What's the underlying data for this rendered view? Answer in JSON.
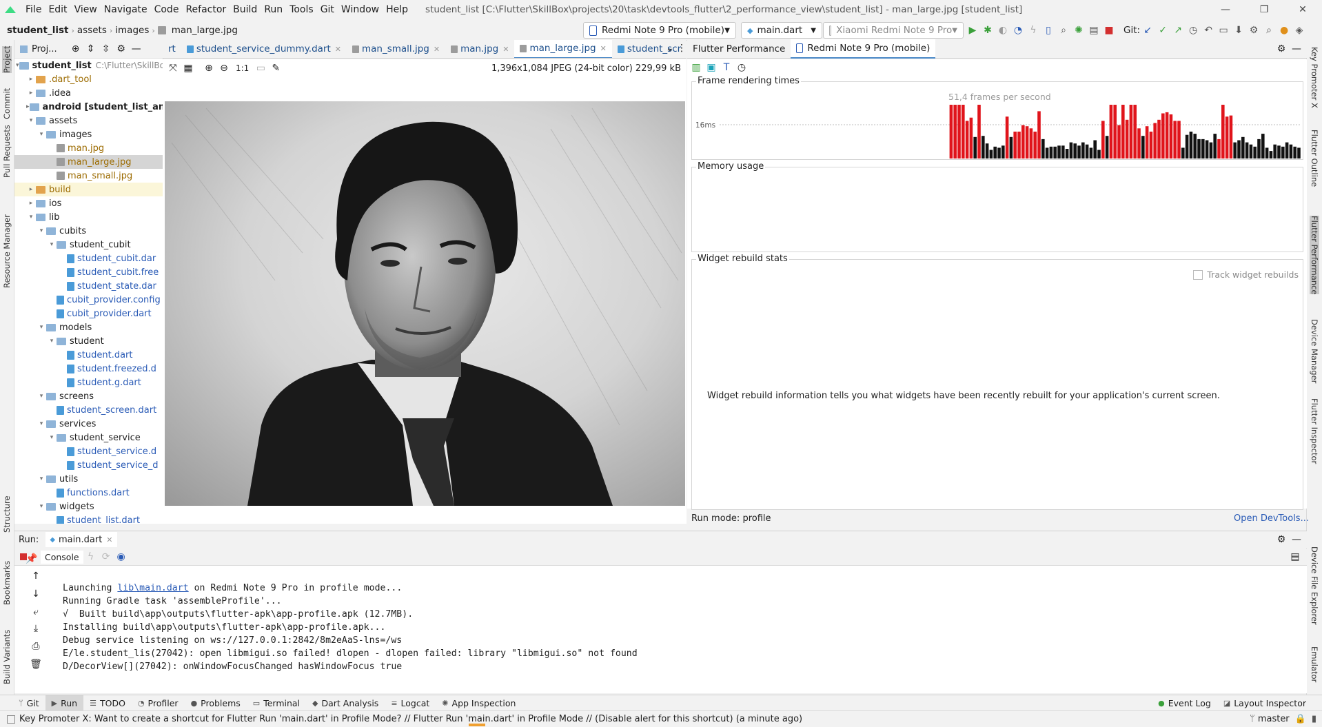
{
  "menubar": {
    "items": [
      "File",
      "Edit",
      "View",
      "Navigate",
      "Code",
      "Refactor",
      "Build",
      "Run",
      "Tools",
      "Git",
      "Window",
      "Help"
    ],
    "window_title": "student_list [C:\\Flutter\\SkillBox\\projects\\20\\task\\devtools_flutter\\2_performance_view\\student_list] - man_large.jpg [student_list]"
  },
  "navbar": {
    "breadcrumbs": [
      "student_list",
      "assets",
      "images",
      "man_large.jpg"
    ],
    "device_selector": "Redmi Note 9 Pro (mobile)",
    "run_config": "main.dart",
    "device_secondary": "Xiaomi Redmi Note 9 Pro",
    "git_label": "Git:"
  },
  "left_stripe": [
    "Project",
    "Commit",
    "Pull Requests",
    "Resource Manager",
    "Structure",
    "Bookmarks",
    "Build Variants"
  ],
  "right_stripe": [
    "Key Promoter X",
    "Flutter Outline",
    "Flutter Performance",
    "Device Manager",
    "Flutter Inspector",
    "Device File Explorer",
    "Emulator"
  ],
  "project": {
    "header": "Proj...",
    "root_name": "student_list",
    "root_path": "C:\\Flutter\\SkillBo",
    "tree": [
      {
        "label": ".dart_tool",
        "depth": 1,
        "kind": "folder-orange",
        "arrow": "▸",
        "style": "yellow"
      },
      {
        "label": ".idea",
        "depth": 1,
        "kind": "folder",
        "arrow": "▸"
      },
      {
        "label": "android [student_list_and",
        "depth": 1,
        "kind": "folder",
        "arrow": "▸",
        "bold": true
      },
      {
        "label": "assets",
        "depth": 1,
        "kind": "folder",
        "arrow": "▾"
      },
      {
        "label": "images",
        "depth": 2,
        "kind": "folder",
        "arrow": "▾"
      },
      {
        "label": "man.jpg",
        "depth": 3,
        "kind": "image",
        "arrow": "",
        "style": "yellow"
      },
      {
        "label": "man_large.jpg",
        "depth": 3,
        "kind": "image",
        "arrow": "",
        "style": "yellow",
        "selected": true
      },
      {
        "label": "man_small.jpg",
        "depth": 3,
        "kind": "image",
        "arrow": "",
        "style": "yellow"
      },
      {
        "label": "build",
        "depth": 1,
        "kind": "folder-orange",
        "arrow": "▸",
        "style": "yellow",
        "highlight": true
      },
      {
        "label": "ios",
        "depth": 1,
        "kind": "folder",
        "arrow": "▸"
      },
      {
        "label": "lib",
        "depth": 1,
        "kind": "folder",
        "arrow": "▾"
      },
      {
        "label": "cubits",
        "depth": 2,
        "kind": "folder",
        "arrow": "▾"
      },
      {
        "label": "student_cubit",
        "depth": 3,
        "kind": "folder",
        "arrow": "▾"
      },
      {
        "label": "student_cubit.dar",
        "depth": 4,
        "kind": "file",
        "arrow": "",
        "style": "blue"
      },
      {
        "label": "student_cubit.free",
        "depth": 4,
        "kind": "file",
        "arrow": "",
        "style": "blue"
      },
      {
        "label": "student_state.dar",
        "depth": 4,
        "kind": "file",
        "arrow": "",
        "style": "blue"
      },
      {
        "label": "cubit_provider.config",
        "depth": 3,
        "kind": "file",
        "arrow": "",
        "style": "blue"
      },
      {
        "label": "cubit_provider.dart",
        "depth": 3,
        "kind": "file",
        "arrow": "",
        "style": "blue"
      },
      {
        "label": "models",
        "depth": 2,
        "kind": "folder",
        "arrow": "▾"
      },
      {
        "label": "student",
        "depth": 3,
        "kind": "folder",
        "arrow": "▾"
      },
      {
        "label": "student.dart",
        "depth": 4,
        "kind": "file",
        "arrow": "",
        "style": "blue"
      },
      {
        "label": "student.freezed.d",
        "depth": 4,
        "kind": "file",
        "arrow": "",
        "style": "blue"
      },
      {
        "label": "student.g.dart",
        "depth": 4,
        "kind": "file",
        "arrow": "",
        "style": "blue"
      },
      {
        "label": "screens",
        "depth": 2,
        "kind": "folder",
        "arrow": "▾"
      },
      {
        "label": "student_screen.dart",
        "depth": 3,
        "kind": "file",
        "arrow": "",
        "style": "blue"
      },
      {
        "label": "services",
        "depth": 2,
        "kind": "folder",
        "arrow": "▾"
      },
      {
        "label": "student_service",
        "depth": 3,
        "kind": "folder",
        "arrow": "▾"
      },
      {
        "label": "student_service.d",
        "depth": 4,
        "kind": "file",
        "arrow": "",
        "style": "blue"
      },
      {
        "label": "student_service_d",
        "depth": 4,
        "kind": "file",
        "arrow": "",
        "style": "blue"
      },
      {
        "label": "utils",
        "depth": 2,
        "kind": "folder",
        "arrow": "▾"
      },
      {
        "label": "functions.dart",
        "depth": 3,
        "kind": "file",
        "arrow": "",
        "style": "blue"
      },
      {
        "label": "widgets",
        "depth": 2,
        "kind": "folder",
        "arrow": "▾"
      },
      {
        "label": "student_list.dart",
        "depth": 3,
        "kind": "file",
        "arrow": "",
        "style": "blue"
      }
    ]
  },
  "editor": {
    "tabs": [
      {
        "label": "rt",
        "active": false,
        "closable": false
      },
      {
        "label": "student_service_dummy.dart",
        "active": false,
        "closable": true
      },
      {
        "label": "man_small.jpg",
        "active": false,
        "closable": true
      },
      {
        "label": "man.jpg",
        "active": false,
        "closable": true
      },
      {
        "label": "man_large.jpg",
        "active": true,
        "closable": true
      },
      {
        "label": "student_scr",
        "active": false,
        "closable": false
      }
    ],
    "zoom_label": "1:1",
    "image_info": "1,396x1,084 JPEG (24-bit color) 229,99 kB"
  },
  "flutter_performance": {
    "tabs": [
      "Flutter Performance",
      "Redmi Note 9 Pro (mobile)"
    ],
    "frame_title": "Frame rendering times",
    "fps_label": "51,4 frames per second",
    "threshold_label": "16ms",
    "frames": [
      {
        "h": 1.0,
        "jank": true
      },
      {
        "h": 1.0,
        "jank": true
      },
      {
        "h": 1.0,
        "jank": true
      },
      {
        "h": 1.0,
        "jank": true
      },
      {
        "h": 0.7,
        "jank": true
      },
      {
        "h": 0.76,
        "jank": true
      },
      {
        "h": 0.4,
        "jank": false
      },
      {
        "h": 1.0,
        "jank": true
      },
      {
        "h": 0.42,
        "jank": false
      },
      {
        "h": 0.28,
        "jank": false
      },
      {
        "h": 0.16,
        "jank": false
      },
      {
        "h": 0.22,
        "jank": false
      },
      {
        "h": 0.2,
        "jank": false
      },
      {
        "h": 0.24,
        "jank": false
      },
      {
        "h": 0.78,
        "jank": true
      },
      {
        "h": 0.4,
        "jank": false
      },
      {
        "h": 0.5,
        "jank": true
      },
      {
        "h": 0.5,
        "jank": true
      },
      {
        "h": 0.62,
        "jank": true
      },
      {
        "h": 0.6,
        "jank": true
      },
      {
        "h": 0.56,
        "jank": true
      },
      {
        "h": 0.5,
        "jank": true
      },
      {
        "h": 0.88,
        "jank": true
      },
      {
        "h": 0.36,
        "jank": false
      },
      {
        "h": 0.2,
        "jank": false
      },
      {
        "h": 0.22,
        "jank": false
      },
      {
        "h": 0.22,
        "jank": false
      },
      {
        "h": 0.24,
        "jank": false
      },
      {
        "h": 0.24,
        "jank": false
      },
      {
        "h": 0.18,
        "jank": false
      },
      {
        "h": 0.3,
        "jank": false
      },
      {
        "h": 0.28,
        "jank": false
      },
      {
        "h": 0.24,
        "jank": false
      },
      {
        "h": 0.3,
        "jank": false
      },
      {
        "h": 0.26,
        "jank": false
      },
      {
        "h": 0.2,
        "jank": false
      },
      {
        "h": 0.34,
        "jank": false
      },
      {
        "h": 0.16,
        "jank": false
      },
      {
        "h": 0.7,
        "jank": true
      },
      {
        "h": 0.42,
        "jank": false
      },
      {
        "h": 1.0,
        "jank": true
      },
      {
        "h": 1.0,
        "jank": true
      },
      {
        "h": 0.62,
        "jank": true
      },
      {
        "h": 1.0,
        "jank": true
      },
      {
        "h": 0.72,
        "jank": true
      },
      {
        "h": 1.0,
        "jank": true
      },
      {
        "h": 1.0,
        "jank": true
      },
      {
        "h": 0.56,
        "jank": true
      },
      {
        "h": 0.42,
        "jank": false
      },
      {
        "h": 0.6,
        "jank": true
      },
      {
        "h": 0.5,
        "jank": true
      },
      {
        "h": 0.66,
        "jank": true
      },
      {
        "h": 0.72,
        "jank": true
      },
      {
        "h": 0.84,
        "jank": true
      },
      {
        "h": 0.86,
        "jank": true
      },
      {
        "h": 0.82,
        "jank": true
      },
      {
        "h": 0.7,
        "jank": true
      },
      {
        "h": 0.7,
        "jank": true
      },
      {
        "h": 0.2,
        "jank": false
      },
      {
        "h": 0.44,
        "jank": false
      },
      {
        "h": 0.5,
        "jank": false
      },
      {
        "h": 0.46,
        "jank": false
      },
      {
        "h": 0.36,
        "jank": false
      },
      {
        "h": 0.36,
        "jank": false
      },
      {
        "h": 0.34,
        "jank": false
      },
      {
        "h": 0.3,
        "jank": false
      },
      {
        "h": 0.46,
        "jank": false
      },
      {
        "h": 0.36,
        "jank": true
      },
      {
        "h": 1.0,
        "jank": true
      },
      {
        "h": 0.78,
        "jank": true
      },
      {
        "h": 0.8,
        "jank": true
      },
      {
        "h": 0.3,
        "jank": false
      },
      {
        "h": 0.34,
        "jank": false
      },
      {
        "h": 0.4,
        "jank": false
      },
      {
        "h": 0.3,
        "jank": false
      },
      {
        "h": 0.26,
        "jank": false
      },
      {
        "h": 0.22,
        "jank": false
      },
      {
        "h": 0.36,
        "jank": false
      },
      {
        "h": 0.46,
        "jank": false
      },
      {
        "h": 0.2,
        "jank": false
      },
      {
        "h": 0.14,
        "jank": false
      },
      {
        "h": 0.26,
        "jank": false
      },
      {
        "h": 0.24,
        "jank": false
      },
      {
        "h": 0.22,
        "jank": false
      },
      {
        "h": 0.3,
        "jank": false
      },
      {
        "h": 0.26,
        "jank": false
      },
      {
        "h": 0.22,
        "jank": false
      },
      {
        "h": 0.2,
        "jank": false
      }
    ],
    "memory_title": "Memory usage",
    "rebuild_title": "Widget rebuild stats",
    "track_label": "Track widget rebuilds",
    "rebuild_info": "Widget rebuild information tells you what widgets have been recently rebuilt for your application's current screen.",
    "run_mode": "Run mode: profile",
    "open_devtools": "Open DevTools..."
  },
  "run_panel": {
    "label": "Run:",
    "tab": "main.dart",
    "console_tab": "Console",
    "log": {
      "l1_prefix": "Launching ",
      "l1_link": "lib\\main.dart",
      "l1_suffix": " on Redmi Note 9 Pro in profile mode...",
      "l2": "Running Gradle task 'assembleProfile'...",
      "l3": "√  Built build\\app\\outputs\\flutter-apk\\app-profile.apk (12.7MB).",
      "l4": "Installing build\\app\\outputs\\flutter-apk\\app-profile.apk...",
      "l5": "Debug service listening on ws://127.0.0.1:2842/8m2eAaS-lns=/ws",
      "l6": "E/le.student_lis(27042): open libmigui.so failed! dlopen - dlopen failed: library \"libmigui.so\" not found",
      "l7": "D/DecorView[](27042): onWindowFocusChanged hasWindowFocus true"
    }
  },
  "bottom_tools": {
    "left": [
      "Git",
      "Run",
      "TODO",
      "Profiler",
      "Problems",
      "Terminal",
      "Dart Analysis",
      "Logcat",
      "App Inspection"
    ],
    "right": [
      "Event Log",
      "Layout Inspector"
    ]
  },
  "status": {
    "message": "Key Promoter X: Want to create a shortcut for Flutter Run 'main.dart' in Profile Mode? // Flutter Run 'main.dart' in Profile Mode // (Disable alert for this shortcut) (a minute ago)",
    "branch": "master"
  },
  "colors": {
    "jank": "#e0141b",
    "normal": "#111111",
    "accent": "#4a88c7",
    "link": "#2a5bb6"
  }
}
